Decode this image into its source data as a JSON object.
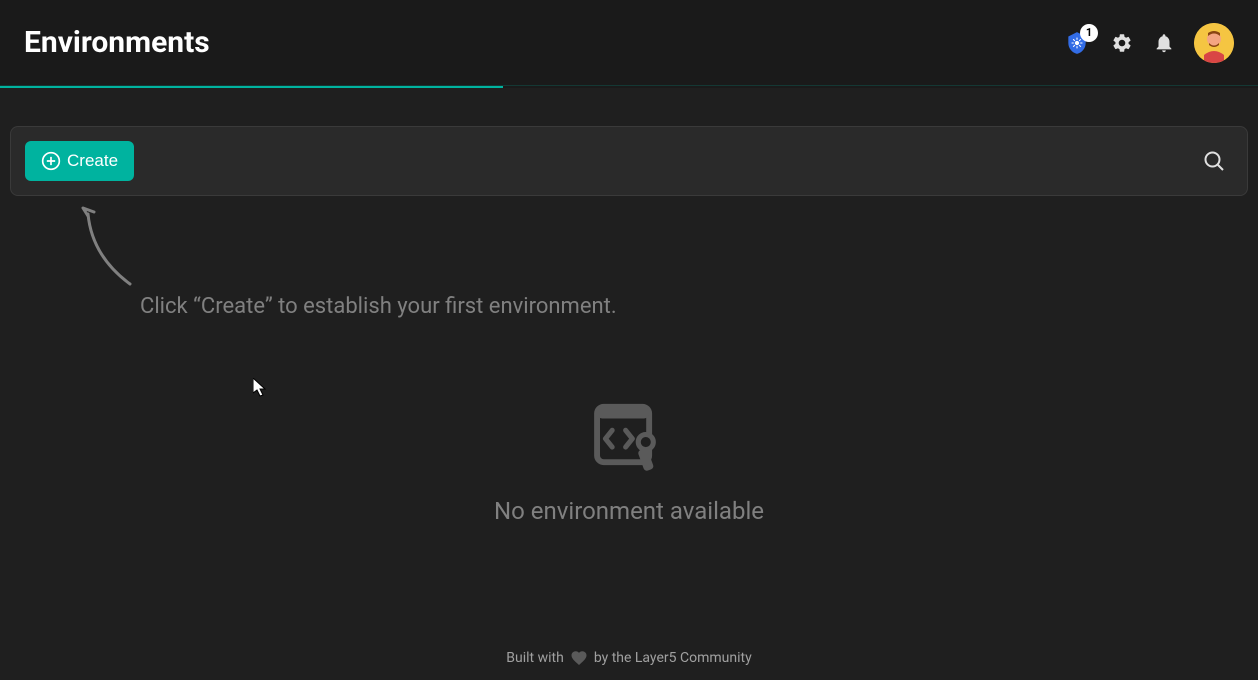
{
  "header": {
    "title": "Environments",
    "k8s_badge_count": "1"
  },
  "toolbar": {
    "create_label": "Create"
  },
  "hint": {
    "text": "Click “Create” to establish your first environment."
  },
  "empty_state": {
    "message": "No environment available"
  },
  "footer": {
    "prefix": "Built with",
    "suffix": "by the Layer5 Community"
  },
  "colors": {
    "accent": "#00b39f",
    "background": "#1a1a1a",
    "panel": "#2a2a2a"
  }
}
